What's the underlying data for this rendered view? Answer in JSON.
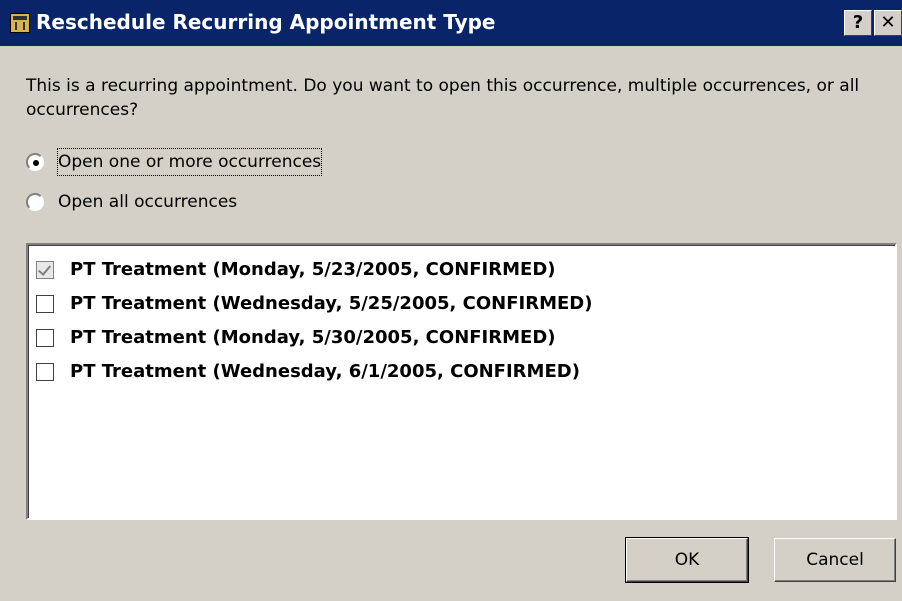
{
  "window": {
    "title": "Reschedule Recurring Appointment Type",
    "help_label": "?",
    "close_label": "✕"
  },
  "prompt": "This is a recurring appointment.  Do you want to open this occurrence, multiple occurrences, or all occurrences?",
  "options": [
    {
      "label": "Open one or more occurrences",
      "selected": true
    },
    {
      "label": "Open all occurrences",
      "selected": false
    }
  ],
  "occurrences": [
    {
      "label": "PT Treatment (Monday, 5/23/2005, CONFIRMED)",
      "checked": true
    },
    {
      "label": "PT Treatment (Wednesday, 5/25/2005, CONFIRMED)",
      "checked": false
    },
    {
      "label": "PT Treatment (Monday, 5/30/2005, CONFIRMED)",
      "checked": false
    },
    {
      "label": "PT Treatment (Wednesday, 6/1/2005, CONFIRMED)",
      "checked": false
    }
  ],
  "buttons": {
    "ok_label": "OK",
    "cancel_label": "Cancel"
  },
  "colors": {
    "titlebar": "#0a246a",
    "dialog_bg": "#d4d0c8"
  },
  "icons": {
    "app": "calendar-icon",
    "help": "help-icon",
    "close": "close-icon"
  }
}
